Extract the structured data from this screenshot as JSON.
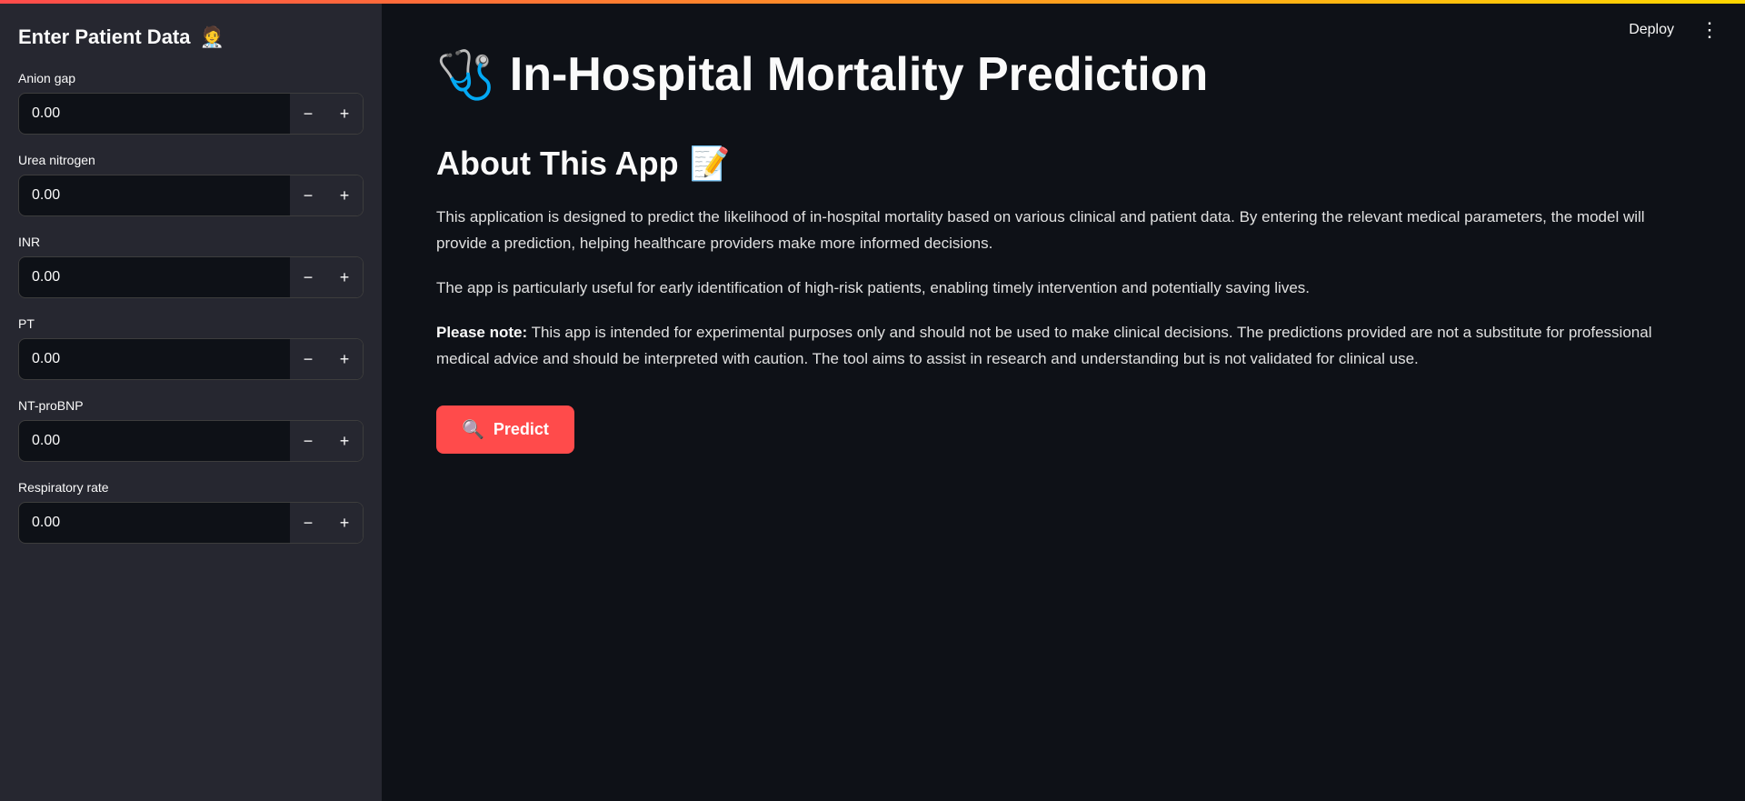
{
  "top_accent": true,
  "header": {
    "deploy_label": "Deploy",
    "more_label": "⋮"
  },
  "sidebar": {
    "title": "Enter Patient Data",
    "title_emoji": "🧑‍⚕️",
    "fields": [
      {
        "label": "Anion gap",
        "value": "0.00"
      },
      {
        "label": "Urea nitrogen",
        "value": "0.00"
      },
      {
        "label": "INR",
        "value": "0.00"
      },
      {
        "label": "PT",
        "value": "0.00"
      },
      {
        "label": "NT-proBNP",
        "value": "0.00"
      },
      {
        "label": "Respiratory rate",
        "value": "0.00"
      }
    ],
    "minus_label": "−",
    "plus_label": "+"
  },
  "main": {
    "app_icon": "🩺",
    "app_title": "In-Hospital Mortality Prediction",
    "about_heading": "About This App",
    "about_icon": "📝",
    "paragraphs": [
      "This application is designed to predict the likelihood of in-hospital mortality based on various clinical and patient data. By entering the relevant medical parameters, the model will provide a prediction, helping healthcare providers make more informed decisions.",
      "The app is particularly useful for early identification of high-risk patients, enabling timely intervention and potentially saving lives.",
      ""
    ],
    "disclaimer_bold": "Please note:",
    "disclaimer_rest": " This app is intended for experimental purposes only and should not be used to make clinical decisions. The predictions provided are not a substitute for professional medical advice and should be interpreted with caution. The tool aims to assist in research and understanding but is not validated for clinical use.",
    "predict_icon": "🔍",
    "predict_label": "Predict"
  }
}
